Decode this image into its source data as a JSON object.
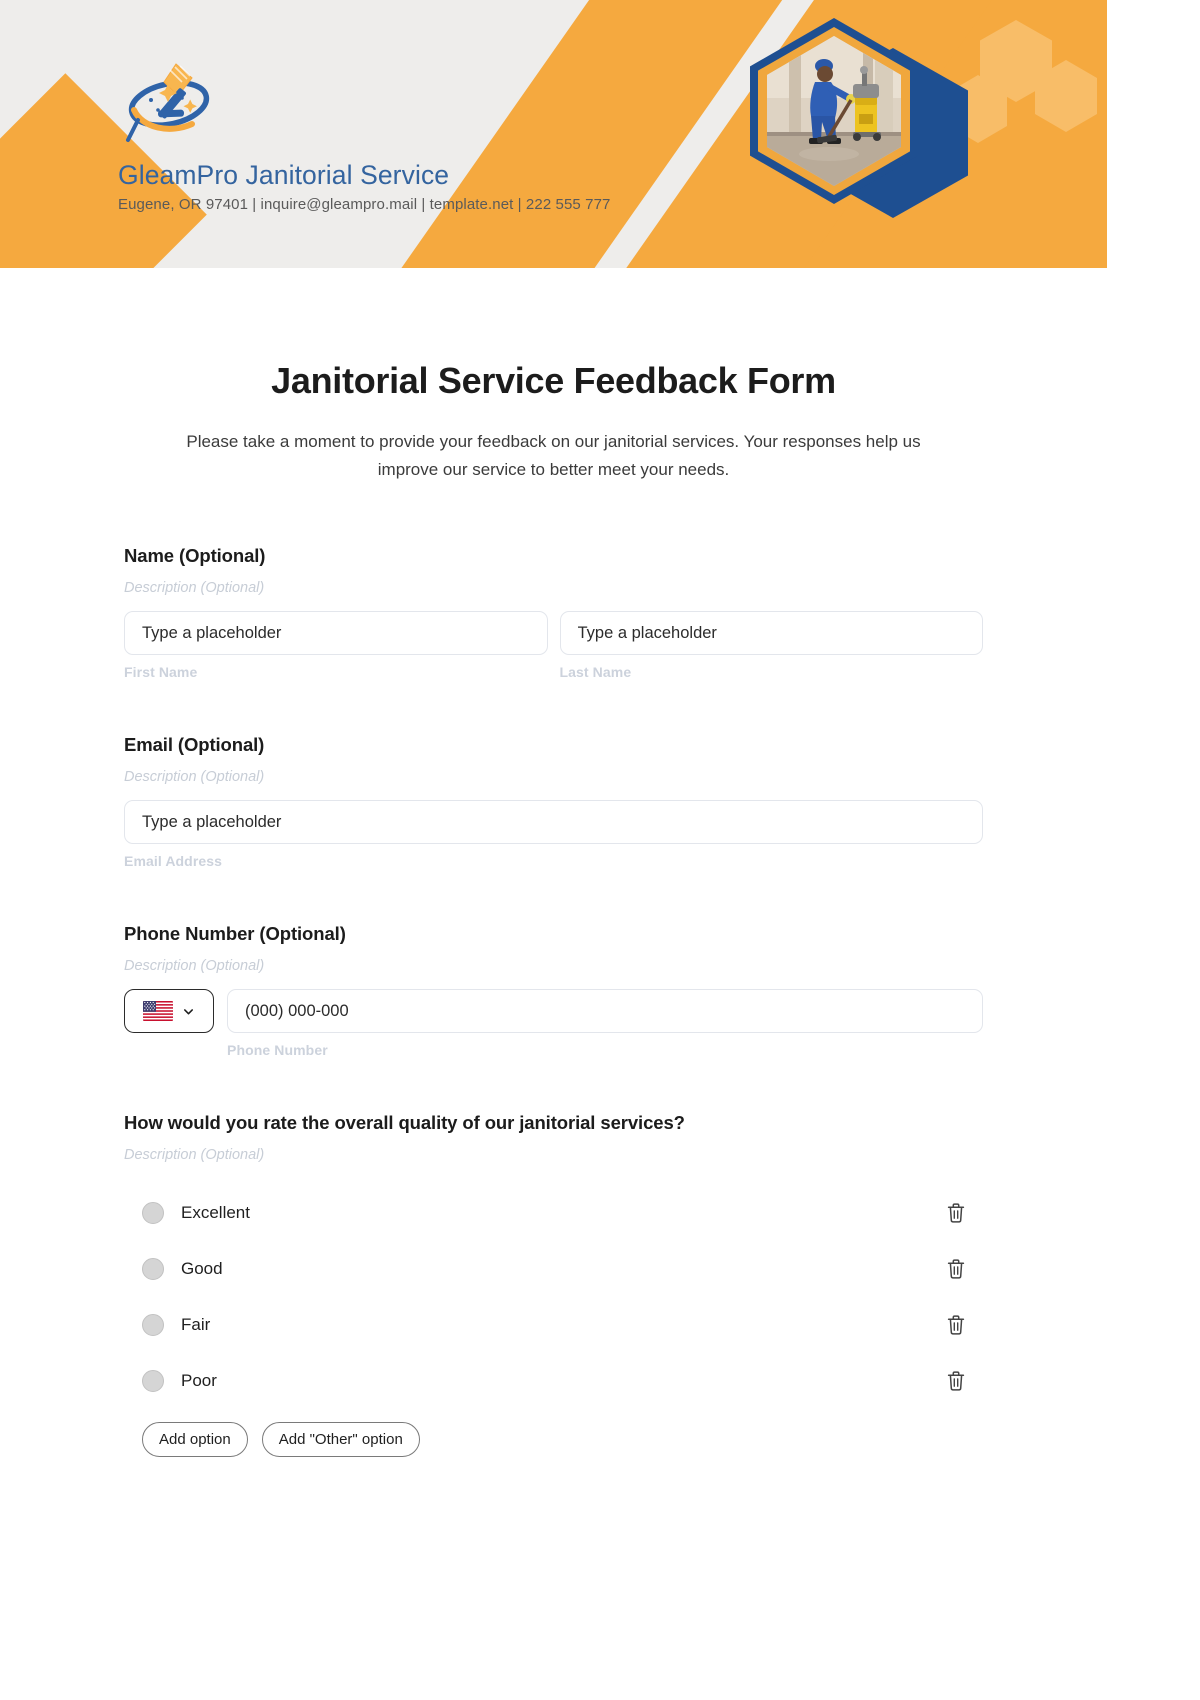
{
  "header": {
    "brand_name": "GleamPro Janitorial Service",
    "contact_line": "Eugene, OR 97401 | inquire@gleampro.mail | template.net | 222 555 777",
    "logo_icon": "broom-sparkle-logo-icon",
    "photo_icon": "janitor-mopping-photo"
  },
  "form": {
    "title": "Janitorial Service Feedback Form",
    "description": "Please take a moment to provide your feedback on our janitorial services. Your responses help us improve our service to better meet your needs.",
    "fields": [
      {
        "label": "Name (Optional)",
        "description": "Description (Optional)",
        "inputs": [
          {
            "placeholder": "Type a placeholder",
            "value": "",
            "sub_label": "First Name"
          },
          {
            "placeholder": "Type a placeholder",
            "value": "",
            "sub_label": "Last Name"
          }
        ]
      },
      {
        "label": "Email (Optional)",
        "description": "Description (Optional)",
        "inputs": [
          {
            "placeholder": "Type a placeholder",
            "value": "",
            "sub_label": "Email Address"
          }
        ]
      },
      {
        "label": "Phone Number (Optional)",
        "description": "Description (Optional)",
        "country_flag": "us-flag-icon",
        "country_chevron": "chevron-down-icon",
        "phone_placeholder": "(000) 000-000",
        "phone_value": "",
        "sub_label": "Phone Number"
      }
    ],
    "question": {
      "label": "How would you rate the overall quality of our janitorial services?",
      "description": "Description (Optional)",
      "options": [
        {
          "label": "Excellent",
          "selected": false,
          "delete_icon": "trash-icon"
        },
        {
          "label": "Good",
          "selected": false,
          "delete_icon": "trash-icon"
        },
        {
          "label": "Fair",
          "selected": false,
          "delete_icon": "trash-icon"
        },
        {
          "label": "Poor",
          "selected": false,
          "delete_icon": "trash-icon"
        }
      ],
      "add_option_label": "Add option",
      "add_other_option_label": "Add \"Other\" option"
    }
  },
  "colors": {
    "brand_blue": "#34649f",
    "brand_orange": "#f5a93f",
    "header_bg": "#eeedeb",
    "deep_blue": "#1e4f91"
  }
}
